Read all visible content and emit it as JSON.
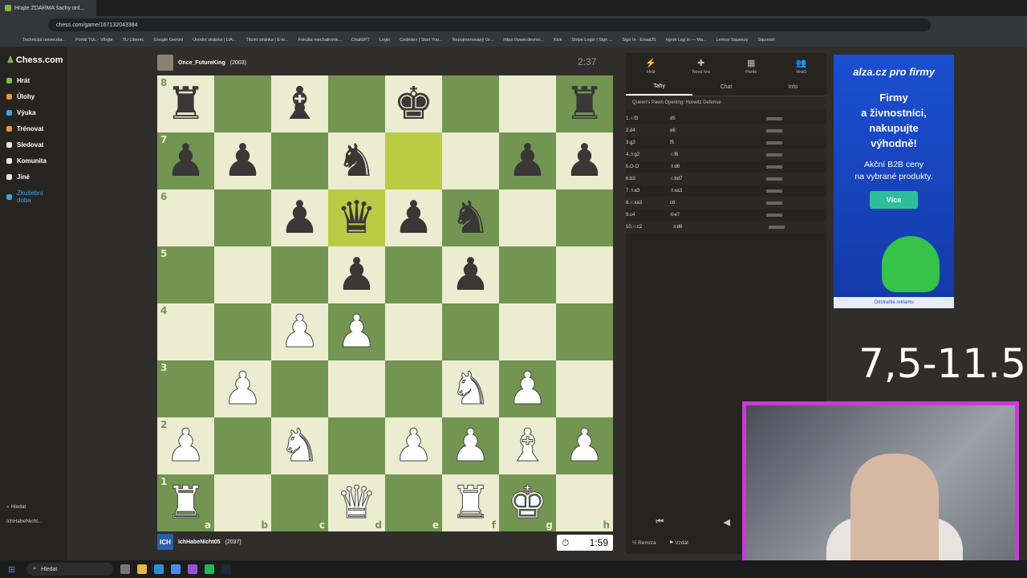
{
  "browser": {
    "tab_title": "Hrajte ZDARMA šachy onl...",
    "url": "chess.com/game/167132043384",
    "bookmarks": [
      "Technická univerzita...",
      "Portál TUL - Vítejte",
      "TU Liberec",
      "Google Gemini",
      "Úvodní stránka | LIA...",
      "Titulní stránka | E-le...",
      "Fakulta mechatronik...",
      "ChatGPT",
      "Login",
      "Codédex | Start You...",
      "Nepojmenovaný Gr...",
      "https://www.desmo...",
      "Kick",
      "Stripe Login | Sign ...",
      "Sign In - EmailJS",
      "ngrok Log in — Ma...",
      "Lemon Squeezy",
      "Squoosh"
    ]
  },
  "sidebar": {
    "logo": "Chess.com",
    "items": [
      {
        "label": "Hrát",
        "color": "#81b64c"
      },
      {
        "label": "Úlohy",
        "color": "#e8963e"
      },
      {
        "label": "Výuka",
        "color": "#3fa0e8"
      },
      {
        "label": "Trénovat",
        "color": "#e8963e"
      },
      {
        "label": "Sledovat",
        "color": "#e5e5e5"
      },
      {
        "label": "Komunita",
        "color": "#e5e5e5"
      },
      {
        "label": "Jiné",
        "color": "#e5e5e5"
      },
      {
        "label": "Zkušební doba",
        "color": "#3fa0e8"
      }
    ],
    "search": "Hledat",
    "user": "IchHabeNicht..."
  },
  "game": {
    "top_player": {
      "name": "Once_FutureKing",
      "rating": "(2003)",
      "clock": "2:37"
    },
    "bottom_player": {
      "name": "IchHabeNicht05",
      "rating": "(2037)",
      "initials": "ICH",
      "clock": "1:59"
    },
    "board": [
      [
        "r",
        "",
        "b",
        "",
        "k",
        "",
        "",
        "r"
      ],
      [
        "p",
        "p",
        "",
        "n",
        "",
        "",
        "p",
        "p"
      ],
      [
        "",
        "",
        "p",
        "q",
        "p",
        "n",
        "",
        ""
      ],
      [
        "",
        "",
        "",
        "p",
        "",
        "p",
        "",
        ""
      ],
      [
        "",
        "",
        "P",
        "P",
        "",
        "",
        "",
        ""
      ],
      [
        "",
        "P",
        "",
        "",
        "",
        "N",
        "P",
        ""
      ],
      [
        "P",
        "",
        "N",
        "",
        "P",
        "P",
        "B",
        "P"
      ],
      [
        "R",
        "",
        "",
        "Q",
        "",
        "R",
        "K",
        ""
      ]
    ],
    "highlights": [
      "e7",
      "d6"
    ],
    "files": [
      "a",
      "b",
      "c",
      "d",
      "e",
      "f",
      "g",
      "h"
    ],
    "ranks": [
      "8",
      "7",
      "6",
      "5",
      "4",
      "3",
      "2",
      "1"
    ]
  },
  "panel": {
    "nav": [
      {
        "label": "Hrát",
        "icon": "⚡"
      },
      {
        "label": "Nová hra",
        "icon": "✚"
      },
      {
        "label": "Partie",
        "icon": "▦"
      },
      {
        "label": "Hráči",
        "icon": "👥"
      }
    ],
    "tabs": [
      "Tahy",
      "Chat",
      "Info"
    ],
    "opening": "Queen's Pawn Opening: Horwitz Defense",
    "moves": [
      {
        "n": "1.",
        "w": "♘f3",
        "b": "d5"
      },
      {
        "n": "2.",
        "w": "d4",
        "b": "e6"
      },
      {
        "n": "3.",
        "w": "g3",
        "b": "f5"
      },
      {
        "n": "4.",
        "w": "♗g2",
        "b": "♘f6"
      },
      {
        "n": "5.",
        "w": "O-O",
        "b": "♗d6"
      },
      {
        "n": "6.",
        "w": "b3",
        "b": "♘bd7"
      },
      {
        "n": "7.",
        "w": "♗a3",
        "b": "♗xa3"
      },
      {
        "n": "8.",
        "w": "♘xa3",
        "b": "c6"
      },
      {
        "n": "9.",
        "w": "c4",
        "b": "♔e7"
      },
      {
        "n": "10.",
        "w": "♘c2",
        "b": "♕d6"
      }
    ],
    "draw": "Remíza",
    "resign": "Vzdát"
  },
  "ad": {
    "brand": "alza.cz pro firmy",
    "headline": [
      "Firmy",
      "a živnostníci,",
      "nakupujte",
      "výhodně!"
    ],
    "sub": [
      "Akční B2B ceny",
      "na vybrané produkty."
    ],
    "button": "Více",
    "remove": "Odstraňte reklamu"
  },
  "overlay": {
    "score": "7,5-11.5"
  },
  "taskbar": {
    "search": "Hledat"
  }
}
